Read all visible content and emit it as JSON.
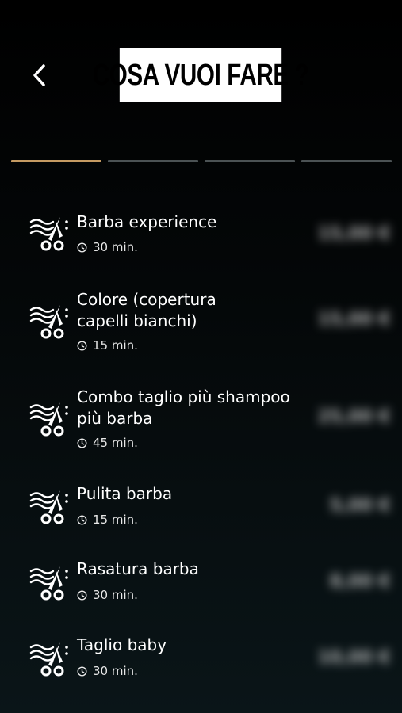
{
  "header": {
    "back_icon": "chevron-left-icon",
    "title": "COSA VUOI FARE ?"
  },
  "progress": {
    "steps": 4,
    "current": 1,
    "active_color": "#c49a62",
    "inactive_color": "#4b5254"
  },
  "services": [
    {
      "icon": "scissors-comb-icon",
      "name": "Barba experience",
      "duration": "30 min.",
      "price": "15,00 €"
    },
    {
      "icon": "scissors-comb-icon",
      "name": "Colore (copertura capelli bianchi)",
      "duration": "15 min.",
      "price": "15,00 €"
    },
    {
      "icon": "scissors-comb-icon",
      "name": "Combo taglio più shampoo più barba",
      "duration": "45 min.",
      "price": "25,00 €"
    },
    {
      "icon": "scissors-comb-icon",
      "name": "Pulita barba",
      "duration": "15 min.",
      "price": "5,00 €"
    },
    {
      "icon": "scissors-comb-icon",
      "name": "Rasatura barba",
      "duration": "30 min.",
      "price": "8,00 €"
    },
    {
      "icon": "scissors-comb-icon",
      "name": "Taglio baby",
      "duration": "30 min.",
      "price": "10,00 €"
    }
  ]
}
